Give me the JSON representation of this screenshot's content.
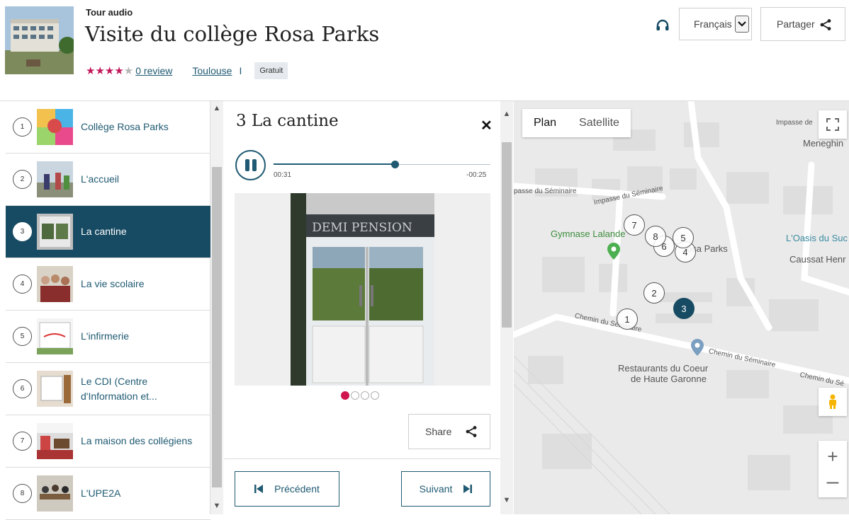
{
  "header": {
    "kicker": "Tour audio",
    "title": "Visite du collège Rosa Parks",
    "rating": 4,
    "reviews_link": "0 review",
    "city_link": "Toulouse",
    "separator": "I",
    "price_badge": "Gratuit",
    "language": "Français",
    "share_label": "Partager"
  },
  "list": {
    "items": [
      {
        "num": "1",
        "label": "Collège Rosa Parks"
      },
      {
        "num": "2",
        "label": "L'accueil"
      },
      {
        "num": "3",
        "label": "La cantine"
      },
      {
        "num": "4",
        "label": "La vie scolaire"
      },
      {
        "num": "5",
        "label": "L'infirmerie"
      },
      {
        "num": "6",
        "label": "Le CDI (Centre d'Information et..."
      },
      {
        "num": "7",
        "label": "La maison des collégiens"
      },
      {
        "num": "8",
        "label": "L'UPE2A"
      }
    ],
    "active_index": 2
  },
  "player": {
    "title": "3 La cantine",
    "time_current": "00:31",
    "time_remaining": "-00:25",
    "progress": 0.56,
    "photo_sign": "DEMI PENSION",
    "slides": 4,
    "active_slide": 0,
    "share_label": "Share",
    "prev_label": "Précédent",
    "next_label": "Suivant"
  },
  "map": {
    "type_plan": "Plan",
    "type_satellite": "Satellite",
    "labels": {
      "impasse_top": "Impasse de",
      "meneghin": "Meneghin",
      "impasse_seminaire_left": "passe du Séminaire",
      "impasse_seminaire": "Impasse du Séminaire",
      "gymnase": "Gymnase Lalande",
      "rosa_parks": "osa Parks",
      "oasis": "L'Oasis du Suc",
      "caussat": "Caussat Henr",
      "chemin_left": "Chemin du Séminaire",
      "chemin_right": "Chemin du Séminaire",
      "chemin_far": "Chemin du Sé",
      "restaurants": "Restaurants du Coeur",
      "restaurants2": "de Haute Garonne"
    },
    "markers": [
      "1",
      "2",
      "3",
      "4",
      "5",
      "6",
      "7",
      "8"
    ],
    "active_marker": "3"
  },
  "colors": {
    "accent": "#174b63",
    "link": "#1f5a72",
    "stars": "#c2185b",
    "slide_dot": "#d0144c"
  }
}
